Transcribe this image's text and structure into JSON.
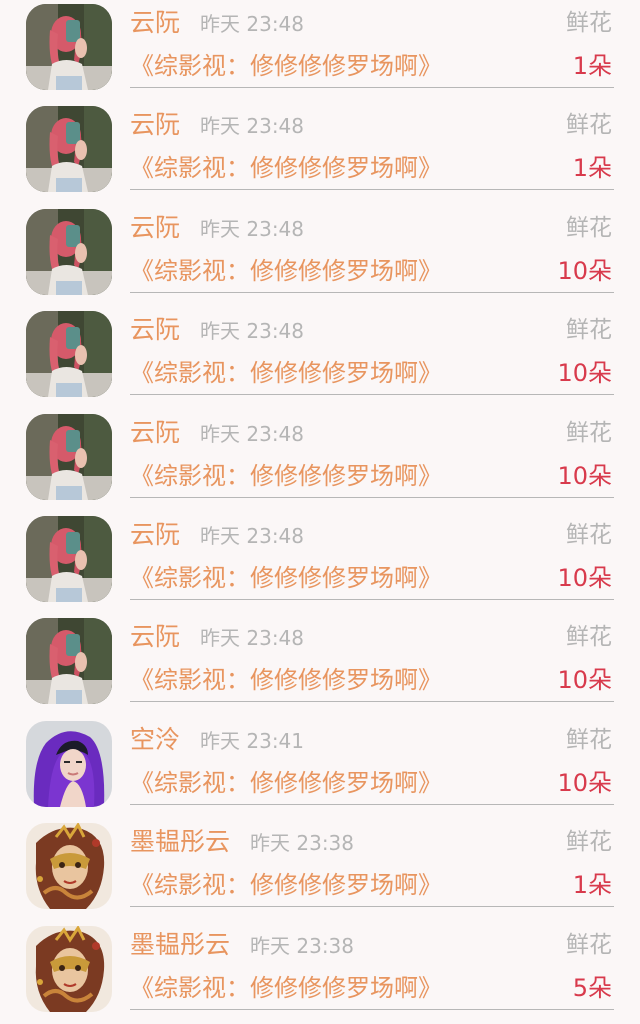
{
  "gift_list": {
    "items": [
      {
        "avatar": "girl-selfie-avatar",
        "name": "云阮",
        "time": "昨天 23:48",
        "gift_type": "鲜花",
        "book": "《综影视：修修修修罗场啊》",
        "amount": "1朵"
      },
      {
        "avatar": "girl-selfie-avatar",
        "name": "云阮",
        "time": "昨天 23:48",
        "gift_type": "鲜花",
        "book": "《综影视：修修修修罗场啊》",
        "amount": "1朵"
      },
      {
        "avatar": "girl-selfie-avatar",
        "name": "云阮",
        "time": "昨天 23:48",
        "gift_type": "鲜花",
        "book": "《综影视：修修修修罗场啊》",
        "amount": "10朵"
      },
      {
        "avatar": "girl-selfie-avatar",
        "name": "云阮",
        "time": "昨天 23:48",
        "gift_type": "鲜花",
        "book": "《综影视：修修修修罗场啊》",
        "amount": "10朵"
      },
      {
        "avatar": "girl-selfie-avatar",
        "name": "云阮",
        "time": "昨天 23:48",
        "gift_type": "鲜花",
        "book": "《综影视：修修修修罗场啊》",
        "amount": "10朵"
      },
      {
        "avatar": "girl-selfie-avatar",
        "name": "云阮",
        "time": "昨天 23:48",
        "gift_type": "鲜花",
        "book": "《综影视：修修修修罗场啊》",
        "amount": "10朵"
      },
      {
        "avatar": "girl-selfie-avatar",
        "name": "云阮",
        "time": "昨天 23:48",
        "gift_type": "鲜花",
        "book": "《综影视：修修修修罗场啊》",
        "amount": "10朵"
      },
      {
        "avatar": "purple-hoodie-avatar",
        "name": "空泠",
        "time": "昨天 23:41",
        "gift_type": "鲜花",
        "book": "《综影视：修修修修罗场啊》",
        "amount": "10朵"
      },
      {
        "avatar": "masked-portrait-avatar",
        "name": "墨韫彤云",
        "time": "昨天 23:38",
        "gift_type": "鲜花",
        "book": "《综影视：修修修修罗场啊》",
        "amount": "1朵"
      },
      {
        "avatar": "masked-portrait-avatar",
        "name": "墨韫彤云",
        "time": "昨天 23:38",
        "gift_type": "鲜花",
        "book": "《综影视：修修修修罗场啊》",
        "amount": "5朵"
      }
    ]
  }
}
